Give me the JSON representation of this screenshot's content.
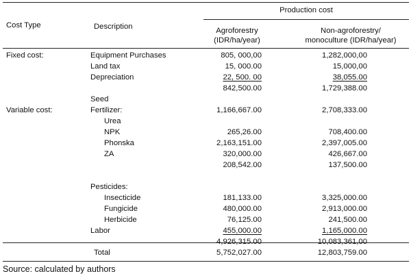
{
  "table": {
    "header": {
      "cost_type": "Cost Type",
      "description": "Description",
      "production_cost": "Production cost",
      "agro_line1": "Agroforestry",
      "agro_line2": "(IDR/ha/year)",
      "nonagro_line1": "Non-agroforestry/",
      "nonagro_line2": "monoculture (IDR/ha/year)"
    },
    "rows": [
      {
        "type": "Fixed cost:",
        "desc": "Equipment Purchases",
        "indent": 0,
        "agro": "805, 000,00",
        "non": "1,282,000,00"
      },
      {
        "type": "",
        "desc": "Land tax",
        "indent": 0,
        "agro": "15, 000.00",
        "non": "15,000,00"
      },
      {
        "type": "",
        "desc": "Depreciation",
        "indent": 0,
        "agro": "22, 500. 00",
        "non": "38,055.00",
        "underline": true
      },
      {
        "type": "",
        "desc": "",
        "indent": 0,
        "agro": "842,500.00",
        "non": "1,729,388.00"
      },
      {
        "type": "",
        "desc": "Seed",
        "indent": 0,
        "agro": "",
        "non": ""
      },
      {
        "type": "Variable cost:",
        "desc": "Fertilizer:",
        "indent": 0,
        "agro": "1,166,667.00",
        "non": "2,708,333.00"
      },
      {
        "type": "",
        "desc": "Urea",
        "indent": 1,
        "agro": "",
        "non": ""
      },
      {
        "type": "",
        "desc": "NPK",
        "indent": 1,
        "agro": "265,26.00",
        "non": "708,400.00"
      },
      {
        "type": "",
        "desc": "Phonska",
        "indent": 1,
        "agro": "2,163,151.00",
        "non": "2,397,005.00"
      },
      {
        "type": "",
        "desc": "ZA",
        "indent": 1,
        "agro": "320,000.00",
        "non": "426,667.00"
      },
      {
        "type": "",
        "desc": "",
        "indent": 0,
        "agro": "208,542.00",
        "non": "137,500.00"
      },
      {
        "type": "",
        "desc": "",
        "indent": 0,
        "agro": "",
        "non": ""
      },
      {
        "type": "",
        "desc": "Pesticides:",
        "indent": 0,
        "agro": "",
        "non": ""
      },
      {
        "type": "",
        "desc": "Insecticide",
        "indent": 1,
        "agro": "181,133.00",
        "non": "3,325,000.00"
      },
      {
        "type": "",
        "desc": "Fungicide",
        "indent": 1,
        "agro": "480,000.00",
        "non": "2,913,000.00"
      },
      {
        "type": "",
        "desc": "Herbicide",
        "indent": 1,
        "agro": "76,125.00",
        "non": "241,500.00"
      },
      {
        "type": "",
        "desc": "Labor",
        "indent": 0,
        "agro": "455,000.00",
        "non": "1,165,000.00",
        "underline": true
      },
      {
        "type": "",
        "desc": "",
        "indent": 0,
        "agro": "4,926,315.00",
        "non": "10,083,361,00"
      }
    ],
    "total": {
      "label": "Total",
      "agro": "5,752,027.00",
      "non": "12,803,759.00"
    }
  },
  "source": "Source: calculated by authors"
}
